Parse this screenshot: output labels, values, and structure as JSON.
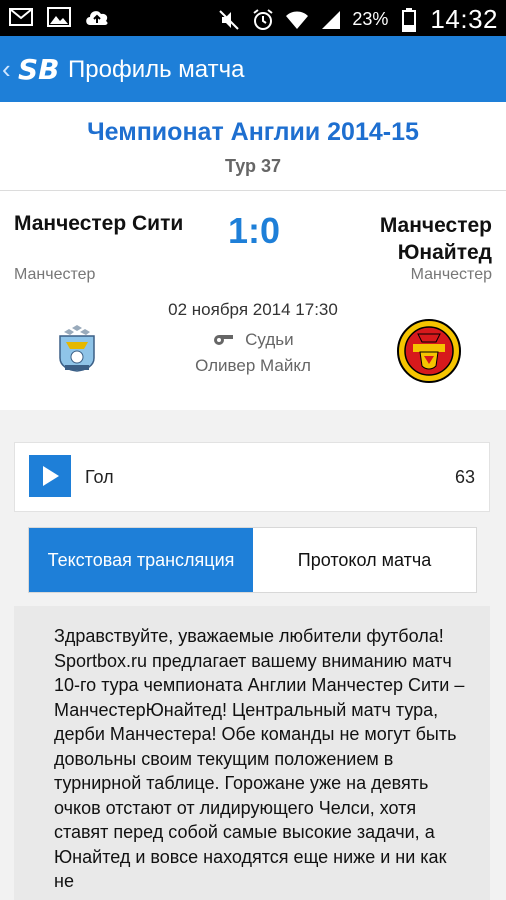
{
  "status_bar": {
    "icons": [
      "mail-icon",
      "image-icon",
      "cloud-upload-icon",
      "mute-icon",
      "alarm-icon",
      "wifi-icon",
      "signal-icon",
      "battery-icon"
    ],
    "battery": "23%",
    "time": "14:32"
  },
  "app_bar": {
    "logo": "SB",
    "title": "Профиль матча"
  },
  "match": {
    "tournament": "Чемпионат Англии 2014-15",
    "round": "Тур 37",
    "home_team": "Манчестер Сити",
    "away_team": "Манчестер Юнайтед",
    "score": "1:0",
    "home_city": "Манчестер",
    "away_city": "Манчестер",
    "datetime": "02 ноября 2014 17:30",
    "referee_label": "Судьи",
    "referee_name": "Оливер Майкл"
  },
  "event": {
    "label": "Гол",
    "minute": "63"
  },
  "tabs": {
    "text_broadcast": "Текстовая трансляция",
    "protocol": "Протокол матча",
    "active": "text_broadcast"
  },
  "article": {
    "text": "Здравствуйте, уважаемые любители футбола! Sportbox.ru предлагает вашему вниманию матч 10-го тура чемпионата Англии Манчестер Сити – МанчестерЮнайтед! Центральный матч тура, дерби Манчестера! Обе команды не могут быть довольны своим текущим положением в турнирной таблице. Горожане уже на девять очков отстают от лидирующего Челси, хотя ставят перед собой самые высокие задачи, а Юнайтед и вовсе находятся еще ниже и ни как не"
  },
  "colors": {
    "primary": "#1e7fd8",
    "tournament_text": "#1e6fd0"
  }
}
